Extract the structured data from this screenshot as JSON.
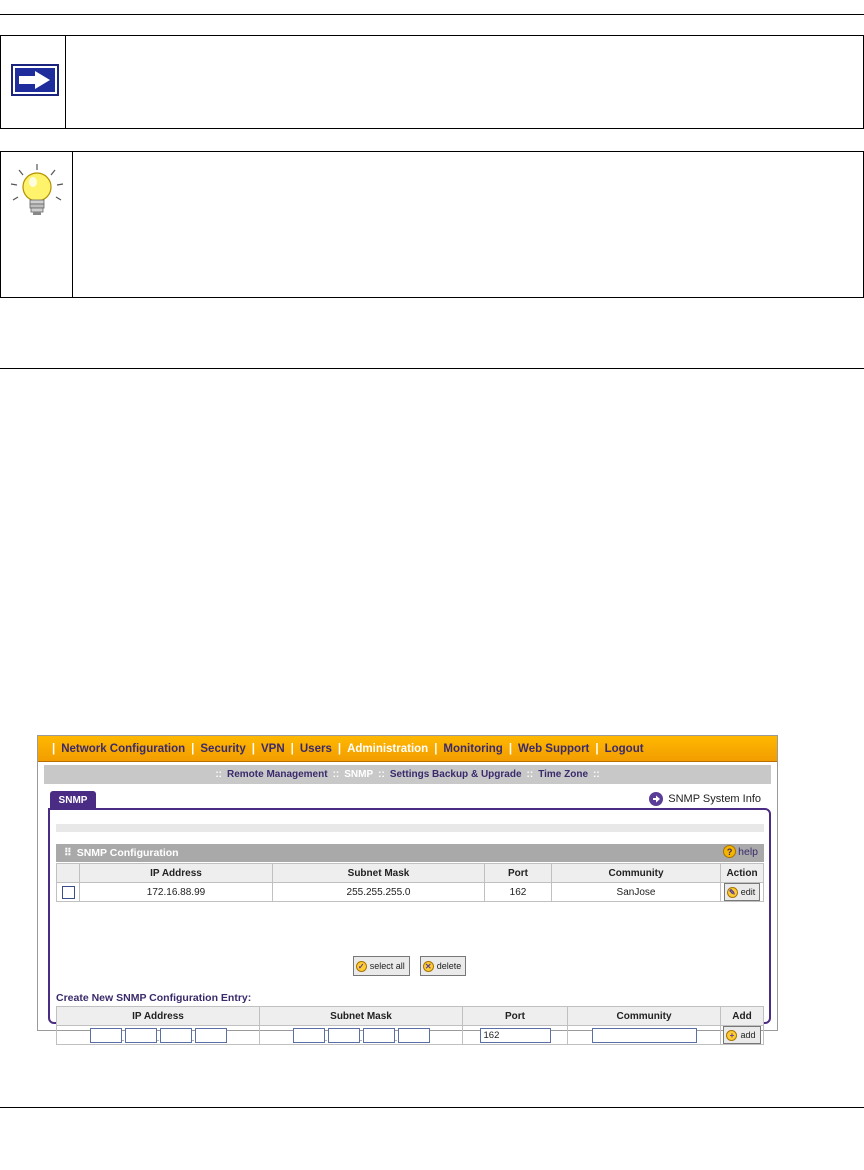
{
  "nav": {
    "items": [
      "Network Configuration",
      "Security",
      "VPN",
      "Users",
      "Administration",
      "Monitoring",
      "Web Support",
      "Logout"
    ],
    "active": "Administration"
  },
  "subnav": {
    "items": [
      "Remote Management",
      "SNMP",
      "Settings Backup & Upgrade",
      "Time Zone"
    ],
    "active": "SNMP"
  },
  "tab": {
    "label": "SNMP"
  },
  "system_info_link": "SNMP System Info",
  "config": {
    "title": "SNMP Configuration",
    "help_label": "help",
    "columns": [
      "IP Address",
      "Subnet Mask",
      "Port",
      "Community",
      "Action"
    ],
    "rows": [
      {
        "ip": "172.16.88.99",
        "mask": "255.255.255.0",
        "port": "162",
        "community": "SanJose",
        "action": "edit"
      }
    ],
    "select_all_label": "select all",
    "delete_label": "delete"
  },
  "create": {
    "title": "Create New SNMP Configuration Entry:",
    "columns": [
      "IP Address",
      "Subnet Mask",
      "Port",
      "Community",
      "Add"
    ],
    "port_value": "162",
    "add_label": "add"
  },
  "colors": {
    "nav_orange": "#f5a800",
    "purple": "#4b2c85",
    "header_grey": "#a9a9a9"
  }
}
